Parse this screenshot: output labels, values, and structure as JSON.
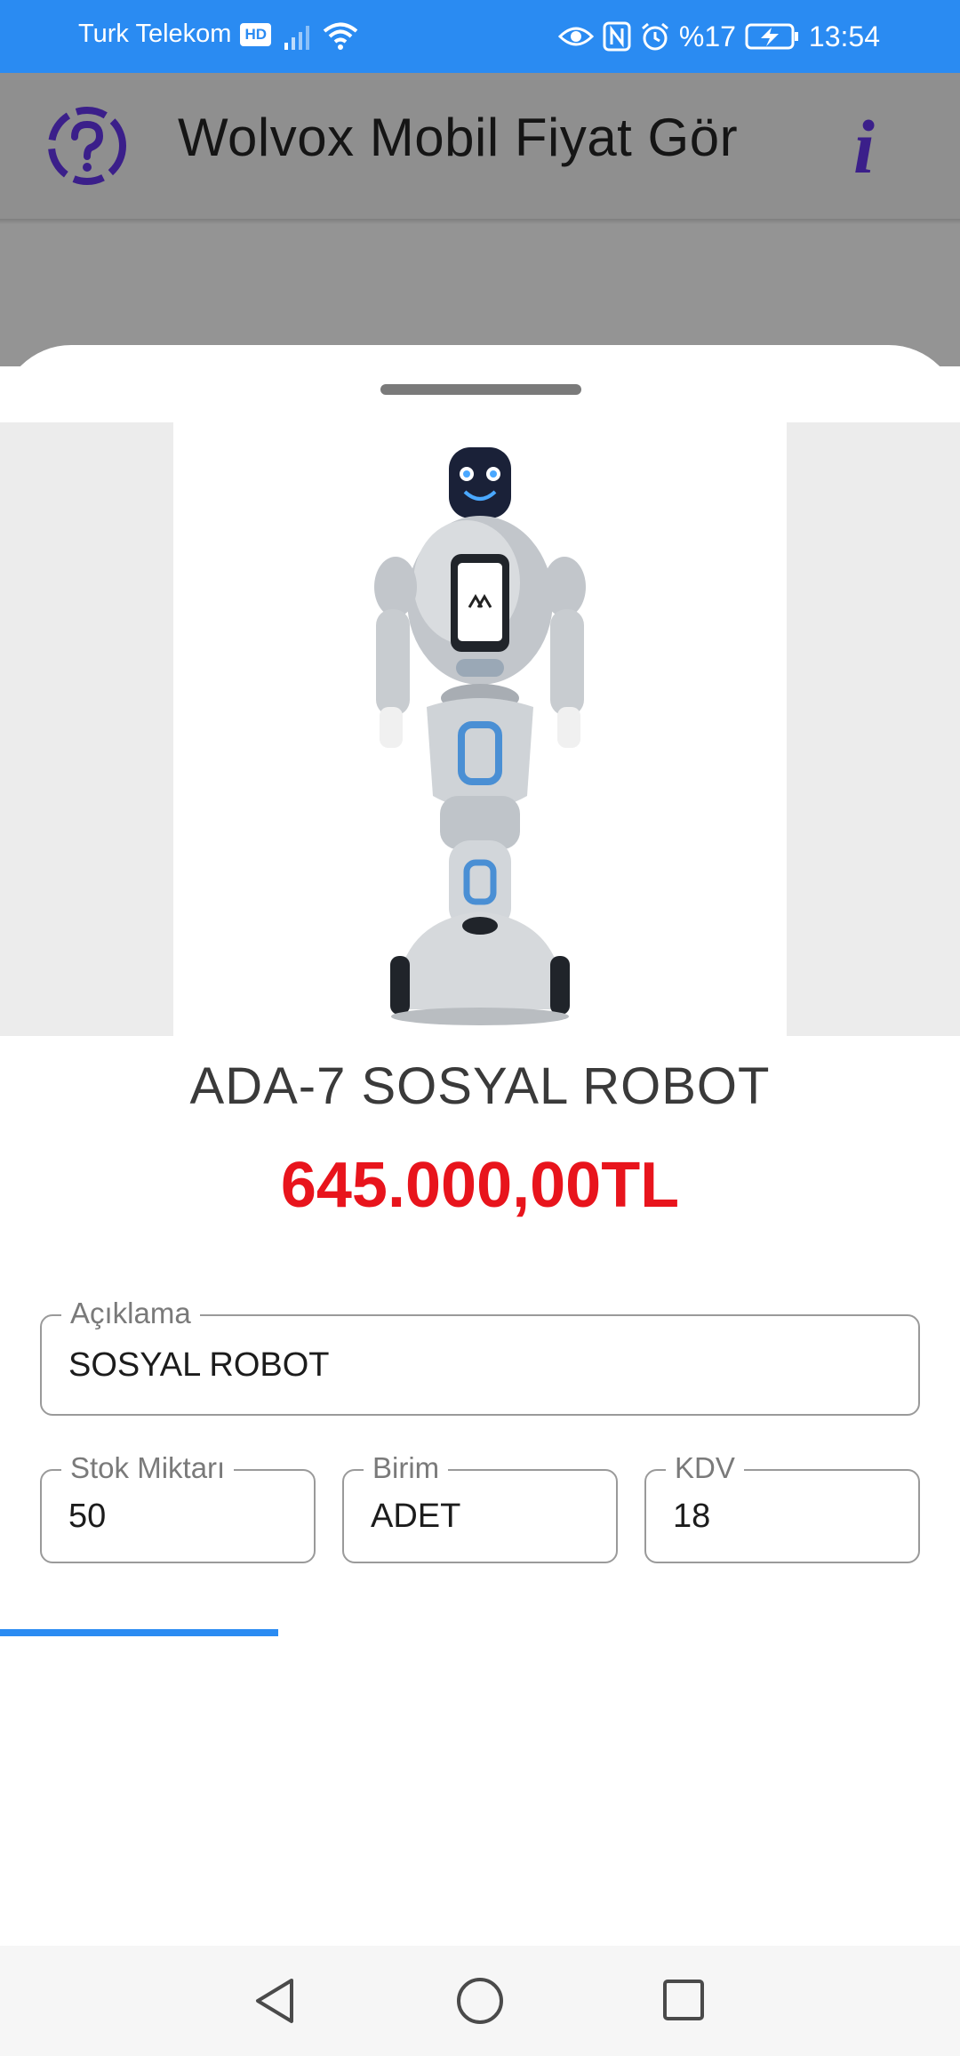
{
  "status_bar": {
    "carrier": "Turk Telekom",
    "hd": "HD",
    "battery": "%17",
    "time": "13:54"
  },
  "app_bar": {
    "title": "Wolvox Mobil Fiyat Gör",
    "info_label": "i"
  },
  "product": {
    "name": "ADA-7 SOSYAL ROBOT",
    "price": "645.000,00TL"
  },
  "fields": {
    "description": {
      "label": "Açıklama",
      "value": "SOSYAL ROBOT"
    },
    "stock": {
      "label": "Stok Miktarı",
      "value": "50"
    },
    "unit": {
      "label": "Birim",
      "value": "ADET"
    },
    "vat": {
      "label": "KDV",
      "value": "18"
    }
  },
  "loading_progress": 0.29,
  "colors": {
    "accent": "#2a8bf2",
    "price": "#e8141c",
    "icon": "#3b1f8a"
  },
  "icons": {
    "help": "help-circle-icon",
    "info": "info-icon",
    "nav_back": "triangle-back-icon",
    "nav_home": "circle-home-icon",
    "nav_recent": "square-recent-icon"
  }
}
